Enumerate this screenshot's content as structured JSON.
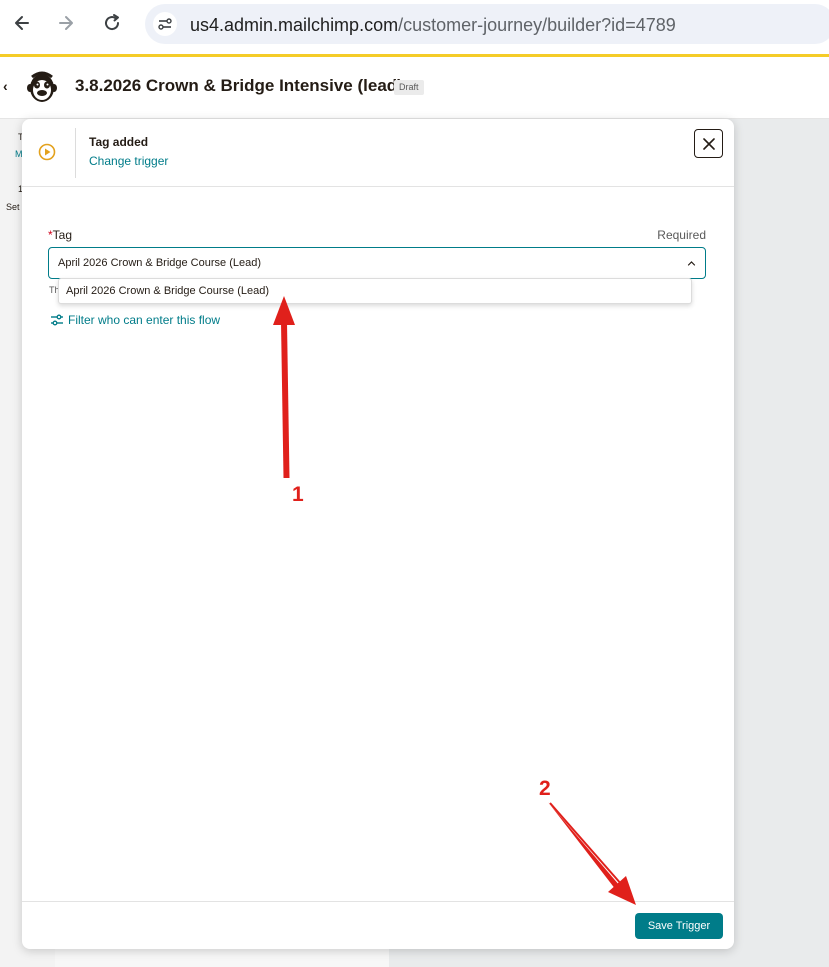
{
  "browser": {
    "url_domain": "us4.admin.mailchimp.com",
    "url_path": "/customer-journey/builder?id=4789"
  },
  "header": {
    "title": "3.8.2026 Crown & Bridge Intensive (lead)",
    "status_badge": "Draft"
  },
  "sidebar": {
    "fragment_1": "T",
    "fragment_2": "M",
    "fragment_3": "1",
    "fragment_4": "Set"
  },
  "modal": {
    "trigger_title": "Tag added",
    "change_trigger_link": "Change trigger",
    "tag_label": "Tag",
    "required_text": "Required",
    "tag_selected_value": "April 2026 Crown & Bridge Course (Lead)",
    "helper_fragment": "Th",
    "dropdown_option": "April 2026 Crown & Bridge Course (Lead)",
    "filter_link": "Filter who can enter this flow",
    "save_button": "Save Trigger"
  },
  "annotations": {
    "label_1": "1",
    "label_2": "2"
  },
  "colors": {
    "brand_teal": "#007c89",
    "accent_yellow": "#f5cc28",
    "annotation_red": "#e0201b",
    "trigger_icon_orange": "#e3a11c"
  },
  "icons": [
    "back-arrow-icon",
    "forward-arrow-icon",
    "reload-icon",
    "site-settings-icon",
    "mailchimp-logo",
    "trigger-play-icon",
    "close-icon",
    "chevron-up-icon",
    "filter-sliders-icon"
  ]
}
